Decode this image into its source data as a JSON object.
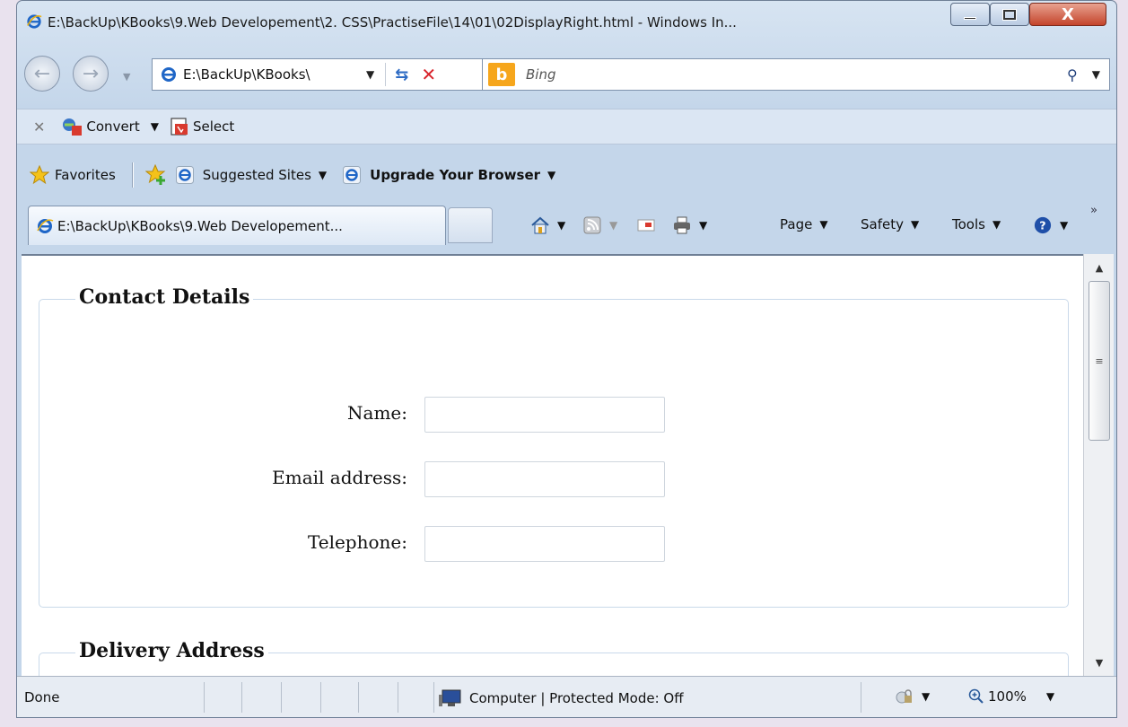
{
  "window": {
    "title": "E:\\BackUp\\KBooks\\9.Web Developement\\2. CSS\\PractiseFile\\14\\01\\02DisplayRight.html - Windows In...",
    "close_glyph": "X"
  },
  "nav": {
    "address": "E:\\BackUp\\KBooks\\",
    "search_placeholder": "Bing"
  },
  "convert_bar": {
    "convert_label": "Convert",
    "select_label": "Select"
  },
  "favorites_bar": {
    "favorites_label": "Favorites",
    "suggested_label": "Suggested Sites",
    "upgrade_label": "Upgrade Your Browser"
  },
  "tab": {
    "label": "E:\\BackUp\\KBooks\\9.Web Developement..."
  },
  "command_bar": {
    "page_label": "Page",
    "safety_label": "Safety",
    "tools_label": "Tools"
  },
  "page": {
    "contact": {
      "legend": "Contact Details",
      "fields": [
        {
          "label": "Name:",
          "value": ""
        },
        {
          "label": "Email address:",
          "value": ""
        },
        {
          "label": "Telephone:",
          "value": ""
        }
      ]
    },
    "delivery": {
      "legend": "Delivery Address"
    }
  },
  "status": {
    "text": "Done",
    "zone": "Computer | Protected Mode: Off",
    "zoom": "100%"
  },
  "icons": {
    "ie": "ie-logo-icon",
    "star": "star-icon",
    "home": "home-icon",
    "rss": "rss-feed-icon",
    "mail": "mail-icon",
    "print": "printer-icon",
    "help": "help-icon"
  },
  "colors": {
    "ie_blue": "#1f66c7",
    "close_red": "#c4442b",
    "bing_orange": "#f6a61c",
    "stop_red": "#d8222a"
  }
}
